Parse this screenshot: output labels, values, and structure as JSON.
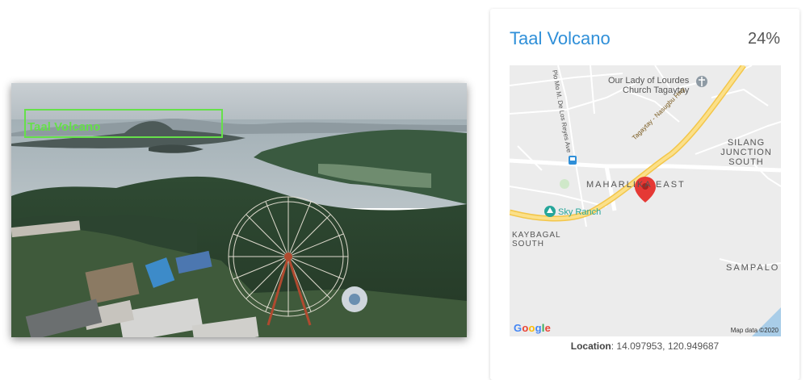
{
  "photo": {
    "detection_label": "Taal Volcano"
  },
  "card": {
    "title": "Taal Volcano",
    "score": "24%",
    "map": {
      "places": {
        "church_line1": "Our Lady of Lourdes",
        "church_line2": "Church Tagaytay",
        "road_name": "Tagaytay - Nasugbu Hwy",
        "side_road": "Pio Mo M. De Los Reyes Ave",
        "silang_line1": "SILANG",
        "silang_line2": "JUNCTION SOUTH",
        "maharlika": "MAHARLIKA EAST",
        "sky_ranch": "Sky Ranch",
        "kaybagal_line1": "KAYBAGAL",
        "kaybagal_line2": "SOUTH",
        "sampalo": "SAMPALO"
      },
      "logo": "Google",
      "attribution": "Map data ©2020"
    },
    "location_label": "Location",
    "location_value": ": 14.097953, 120.949687"
  },
  "icons": {
    "map_pin": "map-pin-icon",
    "place_marker": "place-marker-icon",
    "bus_stop": "bus-stop-icon"
  },
  "colors": {
    "title": "#2f8fd8",
    "detection": "#66e04a",
    "pin": "#e53935",
    "highway": "#f7d25a",
    "poi": "#26a69a"
  }
}
